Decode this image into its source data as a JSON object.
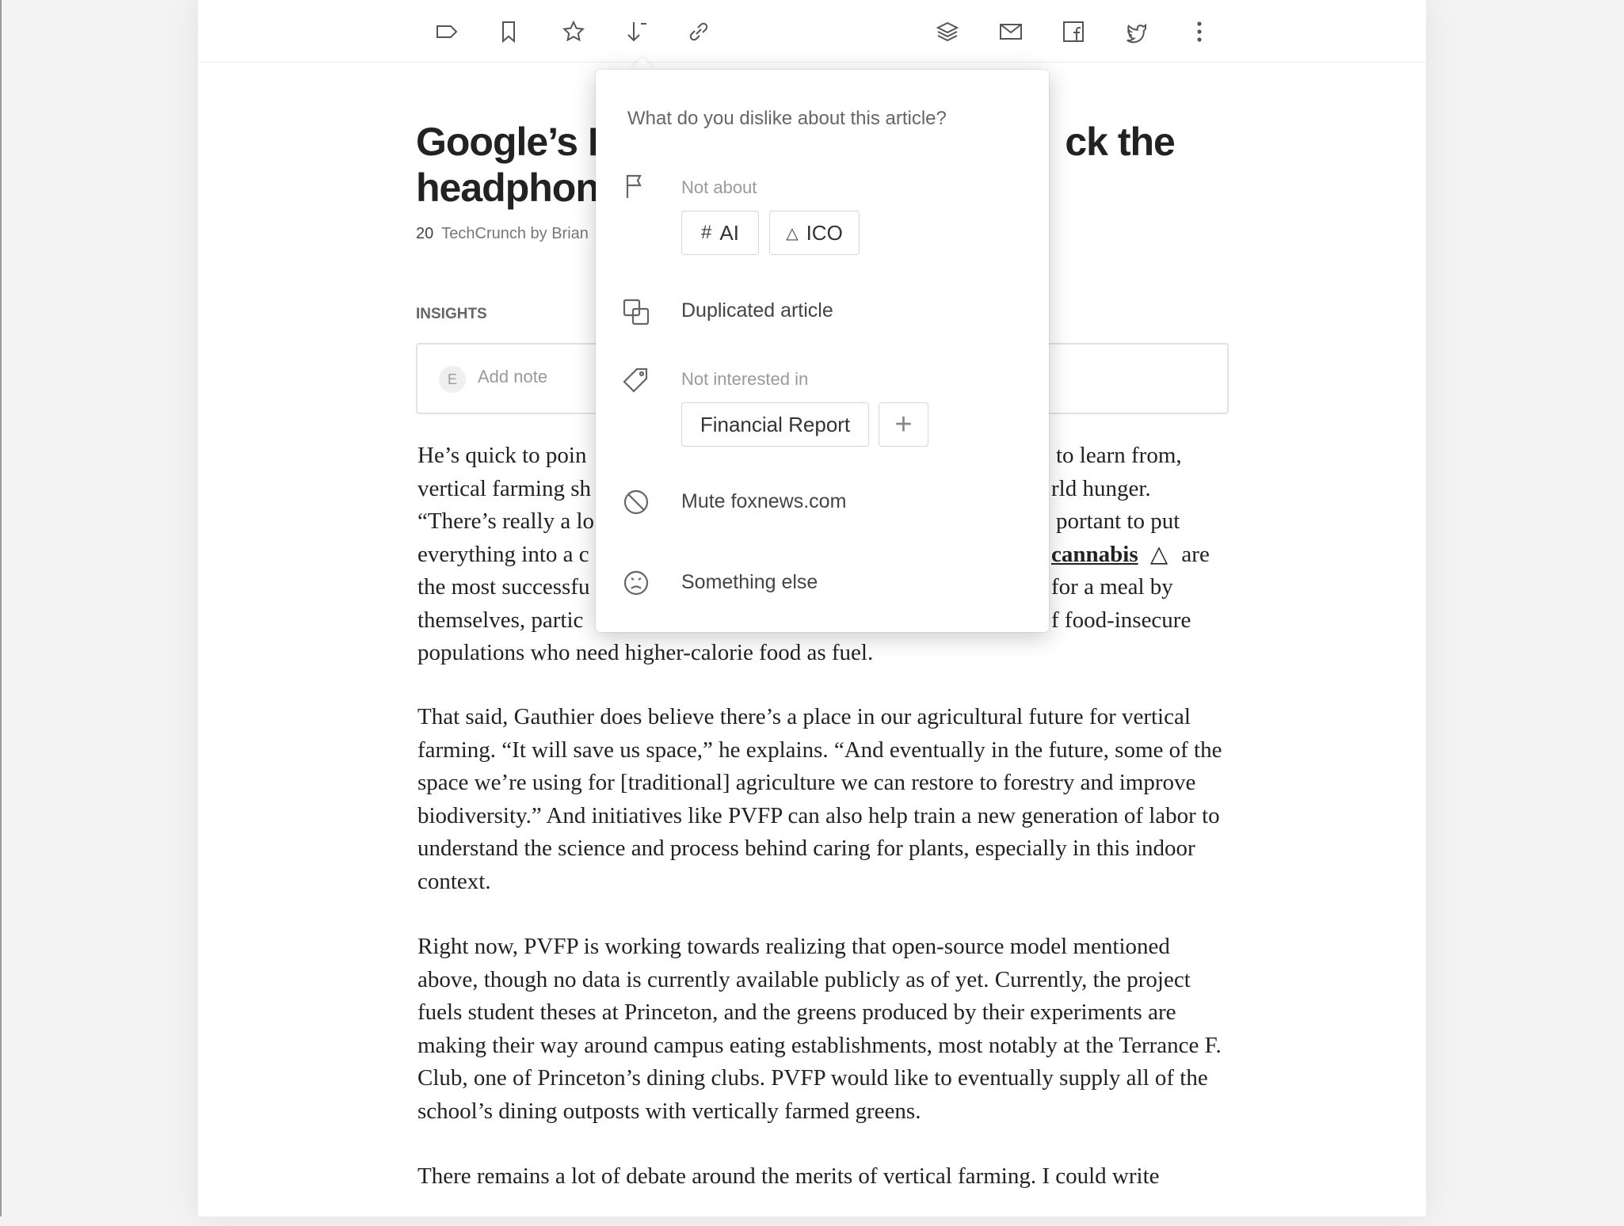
{
  "toolbar": {
    "left_icons": [
      "label-icon",
      "bookmark-icon",
      "star-icon",
      "sort-down-icon",
      "link-icon"
    ],
    "right_icons": [
      "layers-icon",
      "mail-icon",
      "facebook-icon",
      "twitter-icon",
      "more-icon"
    ]
  },
  "article": {
    "title_line1": "Google’s P",
    "title_line1_end": "ck the",
    "title_line2": "headphon",
    "meta_count": "20",
    "meta_source": "TechCrunch by Brian",
    "insights_label": "INSIGHTS",
    "note_avatar": "E",
    "note_placeholder": "Add note",
    "p1_l1a": "He’s quick to poin",
    "p1_l1b": "to learn from,",
    "p1_l2a": "vertical farming sh",
    "p1_l2b": "rld hunger.",
    "p1_l3a": "“There’s really a lo",
    "p1_l3b": "portant to put",
    "p1_l4a": "everything into a c",
    "p1_l4_link": "cannabis",
    "p1_l4b": "are",
    "p1_l5a": "the most successfu",
    "p1_l5b": "for a meal by",
    "p1_l6a": "themselves, partic",
    "p1_l6b": "f food-insecure",
    "p1_l7": "populations who need higher-calorie food as fuel.",
    "p2": "That said, Gauthier does believe there’s a place in our agricultural future for vertical farming. “It will save us space,” he explains. “And eventually in the future, some of the space we’re using for [traditional] agriculture we can restore to forestry and improve biodiversity.” And initiatives like PVFP can also help train a new generation of labor to understand the science and process behind caring for plants, especially in this indoor context.",
    "p3": "Right now, PVFP is working towards realizing that open-source model mentioned above, though no data is currently available publicly as of yet. Currently, the project fuels student theses at Princeton, and the greens produced by their experiments are making their way around campus eating establishments, most notably at the Terrance F. Club, one of Princeton’s dining clubs. PVFP would like to eventually supply all of the school’s dining outposts with vertically farmed greens.",
    "p4": "There remains a lot of debate around the merits of vertical farming. I could write"
  },
  "popup": {
    "title": "What do you dislike about this article?",
    "not_about_label": "Not about",
    "chip_ai_icon": "#",
    "chip_ai": "AI",
    "chip_ico_icon": "△",
    "chip_ico": "ICO",
    "duplicated": "Duplicated article",
    "not_interested_label": "Not interested in",
    "chip_financial": "Financial Report",
    "plus": "+",
    "mute": "Mute foxnews.com",
    "something_else": "Something else"
  }
}
